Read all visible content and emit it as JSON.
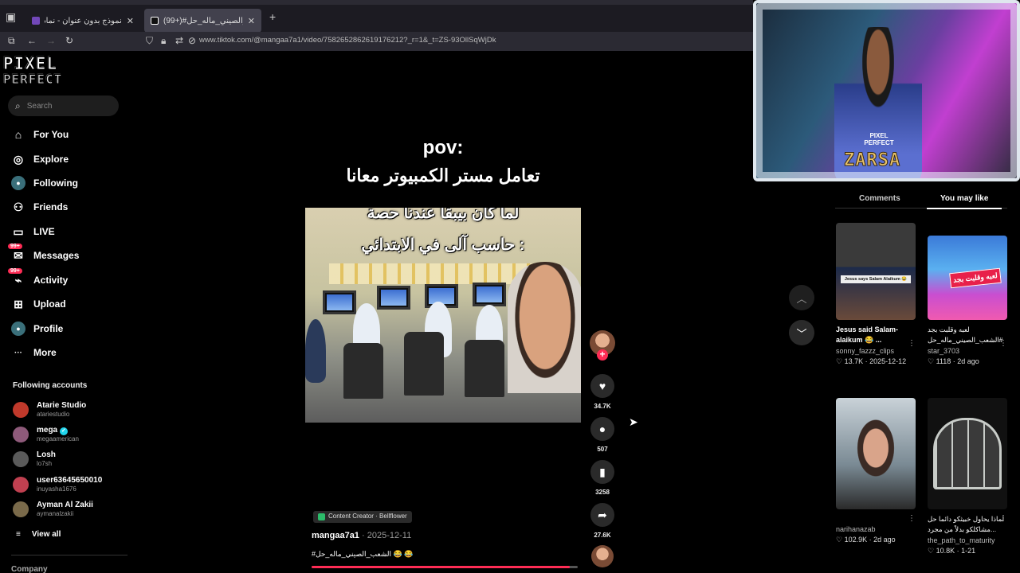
{
  "browser": {
    "tabs": [
      {
        "label": "نموذج بدون عنوان - نماذج Google",
        "color": "#7248b9"
      },
      {
        "label": "(99+)#الشعب_الصيني_ماله_حل",
        "color": "#111111"
      }
    ],
    "url": "www.tiktok.com/@mangaa7a1/video/7582652862619176212?_r=1&_t=ZS-93OllSqWjDk"
  },
  "sidebar": {
    "logo_line1": "PIXEL",
    "logo_line2": "PERFECT",
    "search_placeholder": "Search",
    "nav": [
      {
        "label": "For You",
        "icon": "home-icon",
        "glyph": "⌂"
      },
      {
        "label": "Explore",
        "icon": "compass-icon",
        "glyph": "◎"
      },
      {
        "label": "Following",
        "icon": "following-icon",
        "glyph": "●"
      },
      {
        "label": "Friends",
        "icon": "friends-icon",
        "glyph": "⚇"
      },
      {
        "label": "LIVE",
        "icon": "live-icon",
        "glyph": "▭"
      },
      {
        "label": "Messages",
        "icon": "messages-icon",
        "glyph": "✉",
        "badge": "99+"
      },
      {
        "label": "Activity",
        "icon": "activity-icon",
        "glyph": "⌁",
        "badge": "99+"
      },
      {
        "label": "Upload",
        "icon": "upload-icon",
        "glyph": "⊞"
      },
      {
        "label": "Profile",
        "icon": "profile-icon",
        "glyph": "●"
      },
      {
        "label": "More",
        "icon": "more-icon",
        "glyph": "···"
      }
    ],
    "following_accounts_label": "Following accounts",
    "accounts": [
      {
        "name": "Atarie Studio",
        "handle": "atariestudio",
        "color": "#c0392b"
      },
      {
        "name": "mega",
        "handle": "megaamerican",
        "color": "#8e5a7a",
        "verified": "✓"
      },
      {
        "name": "Losh",
        "handle": "lo7sh",
        "color": "#5a5a5a"
      },
      {
        "name": "user63645650010",
        "handle": "inuyasha1676",
        "color": "#c04050"
      },
      {
        "name": "Ayman Al Zakii",
        "handle": "aymanalzakii",
        "color": "#7a6a4a"
      }
    ],
    "view_all": "View all",
    "company": "Company"
  },
  "video": {
    "overlay_line1": "pov:",
    "overlay_line2": "تعامل مستر الكمبيوتر معانا",
    "caption_line1": "لما كان بيبقا عندنا حصة",
    "caption_line2": "حاسب آلى في الابتدائي :",
    "likes": "34.7K",
    "comments": "507",
    "saves": "3258",
    "shares": "27.6K",
    "creator_tag": "Content Creator · Bellflower",
    "author": "mangaa7a1",
    "date": "2025-12-11",
    "hashtag": "#الشعب_الصيني_ماله_حل 😂 😂",
    "progress_percent": 97
  },
  "webcam": {
    "shirt_text": "PIXEL PERFECT",
    "name_tag": "ZARSA"
  },
  "right_panel": {
    "tabs": [
      "Comments",
      "You may like"
    ],
    "active_tab": "You may like",
    "cards": [
      {
        "title": "Jesus said Salam-alaikum 😂 ...",
        "user": "sonny_fazzz_clips",
        "likes": "13.7K",
        "date": "2025-12-12",
        "thumb_text": "Jesus says Salam Alaikum 😂"
      },
      {
        "title": "لعبه وقلبت بجد #الشعب_الصيني_ماله_حل",
        "user": "star_3703",
        "likes": "1118",
        "date": "2d ago",
        "thumb_text": "لعبه وقلبت بجد"
      },
      {
        "title": "",
        "user": "narihanazab",
        "likes": "102.9K",
        "date": "2d ago",
        "thumb_text": ""
      },
      {
        "title": "لماذا يحاول خبيثكو دائما حل مشاكلكو بدلاً من مجرد...",
        "user": "the_path_to_maturity",
        "likes": "10.8K",
        "date": "1-21",
        "thumb_text": ""
      }
    ]
  }
}
